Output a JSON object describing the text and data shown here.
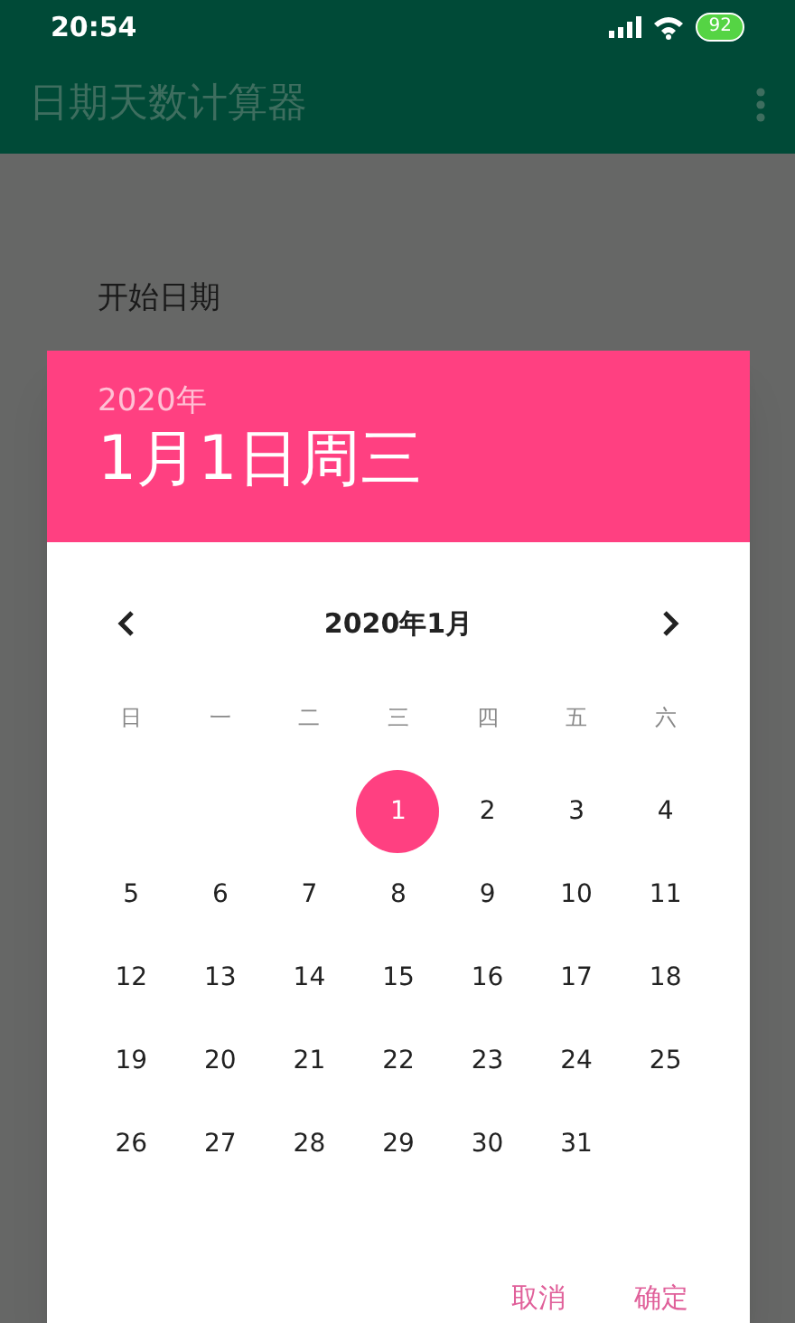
{
  "status_bar": {
    "time": "20:54",
    "battery": "92"
  },
  "app_bar": {
    "title": "日期天数计算器"
  },
  "field_label": "开始日期",
  "dialog": {
    "year": "2020年",
    "date": "1月1日周三",
    "month_title": "2020年1月",
    "weekdays": [
      "日",
      "一",
      "二",
      "三",
      "四",
      "五",
      "六"
    ],
    "weeks": [
      [
        {
          "label": "1",
          "selected": true
        },
        {
          "label": "2",
          "selected": false
        },
        {
          "label": "3",
          "selected": false
        },
        {
          "label": "4",
          "selected": false
        }
      ],
      [
        {
          "label": "5",
          "selected": false
        },
        {
          "label": "6",
          "selected": false
        },
        {
          "label": "7",
          "selected": false
        },
        {
          "label": "8",
          "selected": false
        },
        {
          "label": "9",
          "selected": false
        },
        {
          "label": "10",
          "selected": false
        },
        {
          "label": "11",
          "selected": false
        }
      ],
      [
        {
          "label": "12",
          "selected": false
        },
        {
          "label": "13",
          "selected": false
        },
        {
          "label": "14",
          "selected": false
        },
        {
          "label": "15",
          "selected": false
        },
        {
          "label": "16",
          "selected": false
        },
        {
          "label": "17",
          "selected": false
        },
        {
          "label": "18",
          "selected": false
        }
      ],
      [
        {
          "label": "19",
          "selected": false
        },
        {
          "label": "20",
          "selected": false
        },
        {
          "label": "21",
          "selected": false
        },
        {
          "label": "22",
          "selected": false
        },
        {
          "label": "23",
          "selected": false
        },
        {
          "label": "24",
          "selected": false
        },
        {
          "label": "25",
          "selected": false
        }
      ],
      [
        {
          "label": "26",
          "selected": false
        },
        {
          "label": "27",
          "selected": false
        },
        {
          "label": "28",
          "selected": false
        },
        {
          "label": "29",
          "selected": false
        },
        {
          "label": "30",
          "selected": false
        },
        {
          "label": "31",
          "selected": false
        }
      ]
    ],
    "buttons": [
      "取消",
      "确定"
    ]
  }
}
